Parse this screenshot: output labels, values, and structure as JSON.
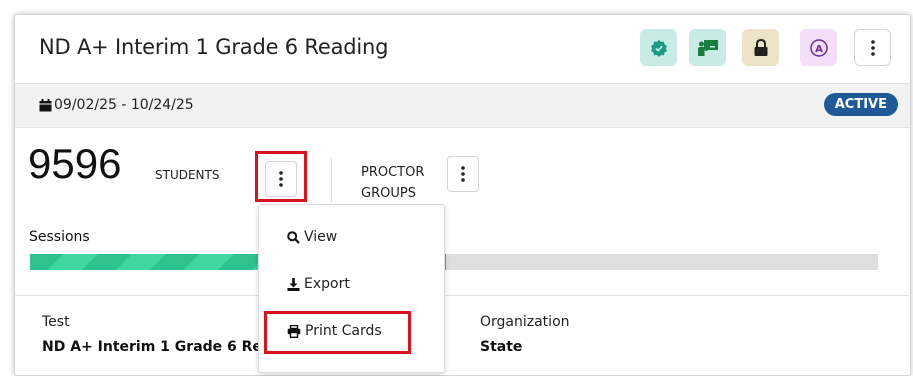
{
  "header": {
    "title": "ND A+ Interim 1 Grade 6 Reading",
    "icons": [
      {
        "name": "verified-badge-icon",
        "bg": "#c8ebe5",
        "fg": "#1a9b86"
      },
      {
        "name": "teacher-board-icon",
        "bg": "#c8ebe5",
        "fg": "#1a7d3e"
      },
      {
        "name": "lock-icon",
        "bg": "#ece3c8",
        "fg": "#222222"
      },
      {
        "name": "accessibility-a-icon",
        "bg": "#f3dff7",
        "fg": "#6a2c91"
      },
      {
        "name": "more-vertical-icon",
        "bg": "#ffffff",
        "fg": "#222222"
      }
    ]
  },
  "date_range": {
    "text": "09/02/25 - 10/24/25",
    "icon": "calendar-icon"
  },
  "status": {
    "label": "ACTIVE",
    "color": "#1f5a96"
  },
  "students": {
    "count": "9596",
    "label": "STUDENTS"
  },
  "proctor": {
    "line1": "PROCTOR",
    "line2": "GROUPS"
  },
  "sessions": {
    "label": "Sessions",
    "progress_percent": 49
  },
  "menu": {
    "items": [
      {
        "label": "View",
        "icon": "search-icon"
      },
      {
        "label": "Export",
        "icon": "download-icon"
      },
      {
        "label": "Print Cards",
        "icon": "printer-icon"
      }
    ]
  },
  "details": {
    "test_label": "Test",
    "test_value": "ND A+ Interim 1 Grade 6 Reading",
    "org_label": "Organization",
    "org_value": "State"
  },
  "colors": {
    "highlight": "#d9141e",
    "progress": "#2fc28f"
  }
}
